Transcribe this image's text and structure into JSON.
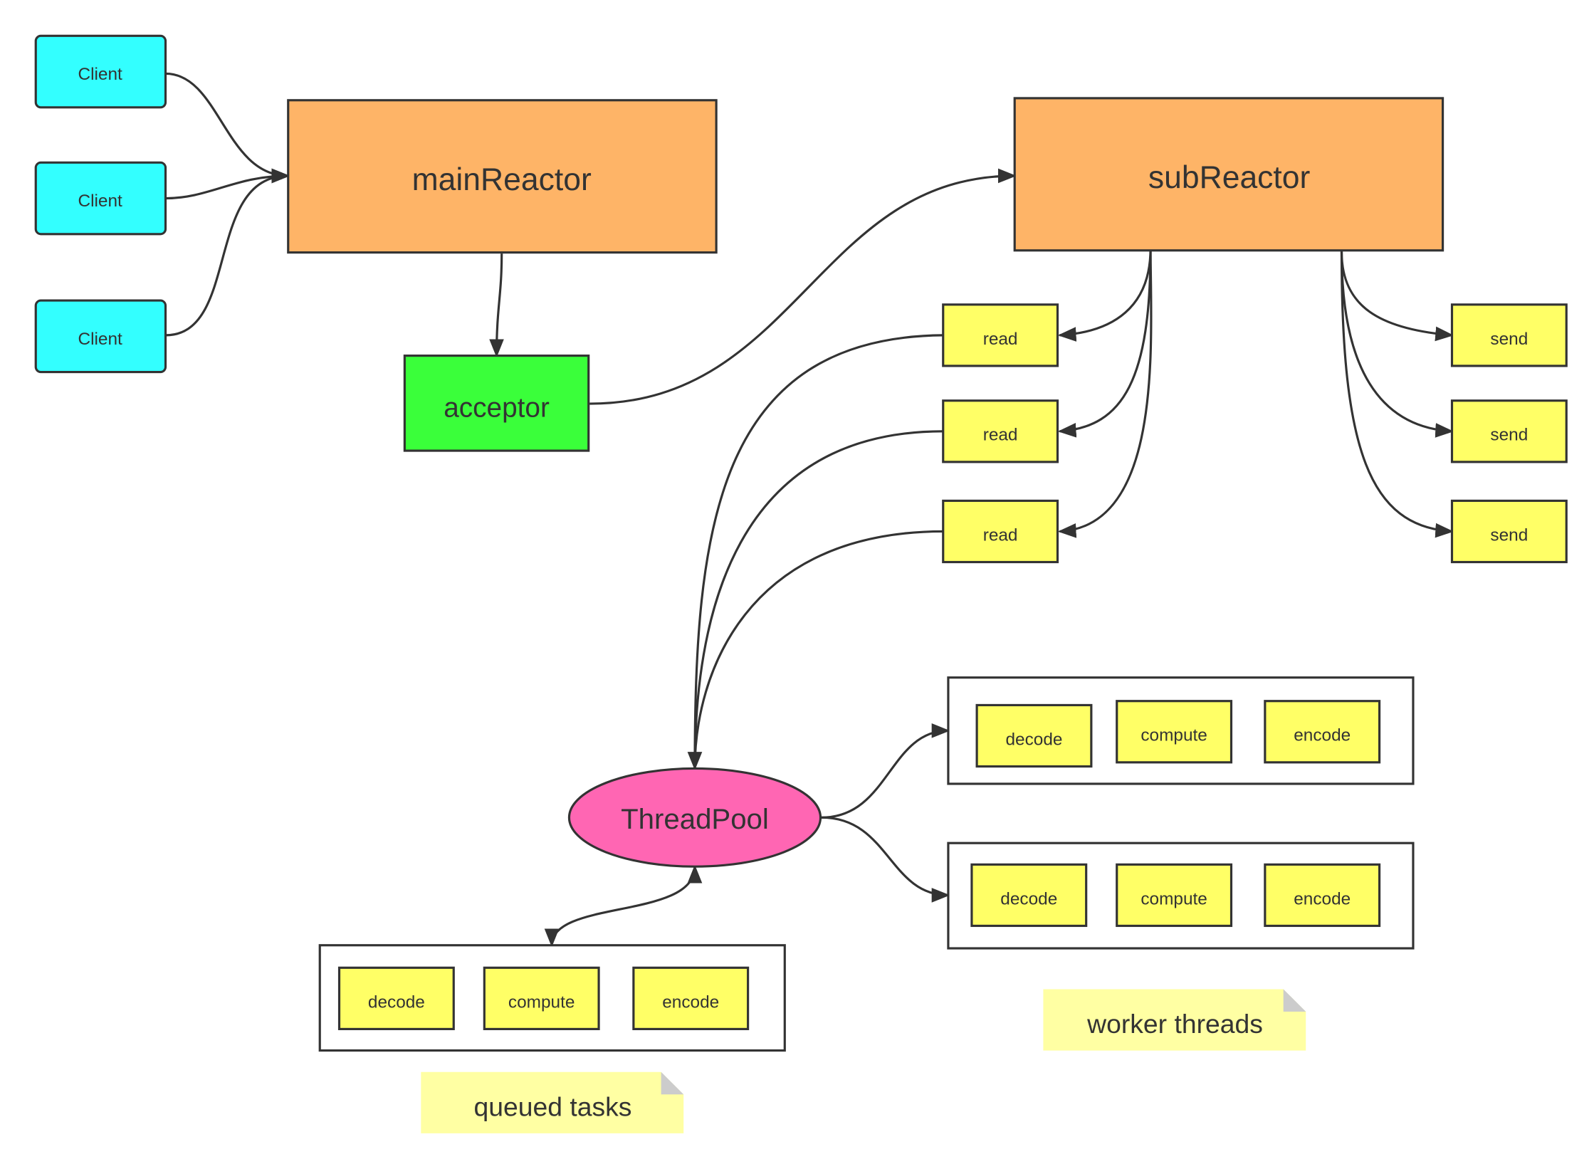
{
  "colors": {
    "client": "#33ffff",
    "reactor": "#feb467",
    "acceptor": "#3aff3a",
    "task": "#ffff66",
    "threadpool": "#ff66b3",
    "note": "#ffffa3",
    "stroke": "#333333"
  },
  "clients": [
    "Client",
    "Client",
    "Client"
  ],
  "main_reactor": "mainReactor",
  "acceptor": "acceptor",
  "sub_reactor": "subReactor",
  "reads": [
    "read",
    "read",
    "read"
  ],
  "sends": [
    "send",
    "send",
    "send"
  ],
  "thread_pool": "ThreadPool",
  "worker_groups": [
    [
      "decode",
      "compute",
      "encode"
    ],
    [
      "decode",
      "compute",
      "encode"
    ]
  ],
  "queued_group": [
    "decode",
    "compute",
    "encode"
  ],
  "notes": {
    "worker": "worker threads",
    "queued": "queued tasks"
  }
}
